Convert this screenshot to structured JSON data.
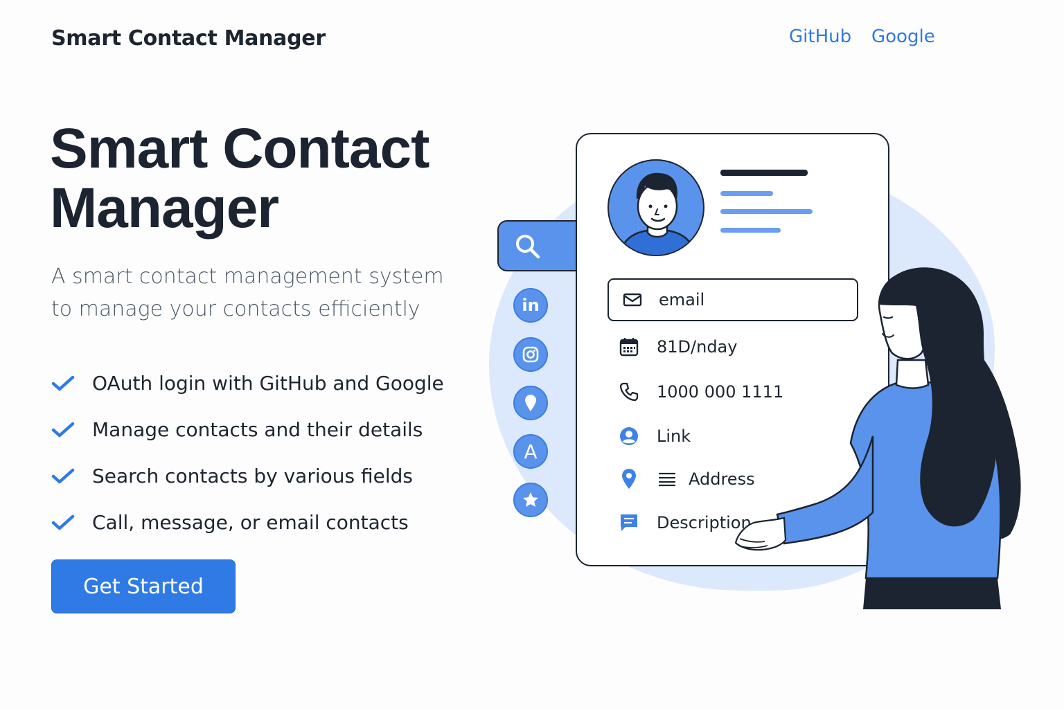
{
  "header": {
    "brand": "Smart Contact Manager",
    "nav": [
      {
        "label": "GitHub"
      },
      {
        "label": "Google"
      }
    ]
  },
  "hero": {
    "title": "Smart Contact Manager",
    "subtitle": "A smart contact management system to manage your contacts efficiently",
    "features": [
      "OAuth login with GitHub and Google",
      "Manage contacts and their details",
      "Search contacts by various fields",
      "Call, message, or email contacts"
    ],
    "cta_label": "Get Started"
  },
  "illustration": {
    "side_icons": [
      "linkedin-icon",
      "instagram-icon",
      "location-pin-icon",
      "letter-a-icon",
      "star-icon"
    ],
    "side_icon_letters": {
      "linkedin": "in",
      "letter_a": "A"
    },
    "fields": {
      "email": "email",
      "date": "81D/nday",
      "phone": "1000 000 1111",
      "link": "Link",
      "address": "Address",
      "description": "Description"
    }
  },
  "colors": {
    "accent": "#2f7ae4",
    "accent_light": "#5a93eb",
    "blob": "#dce8fc",
    "text_dark": "#1d2530",
    "text_muted": "#4a5866"
  }
}
